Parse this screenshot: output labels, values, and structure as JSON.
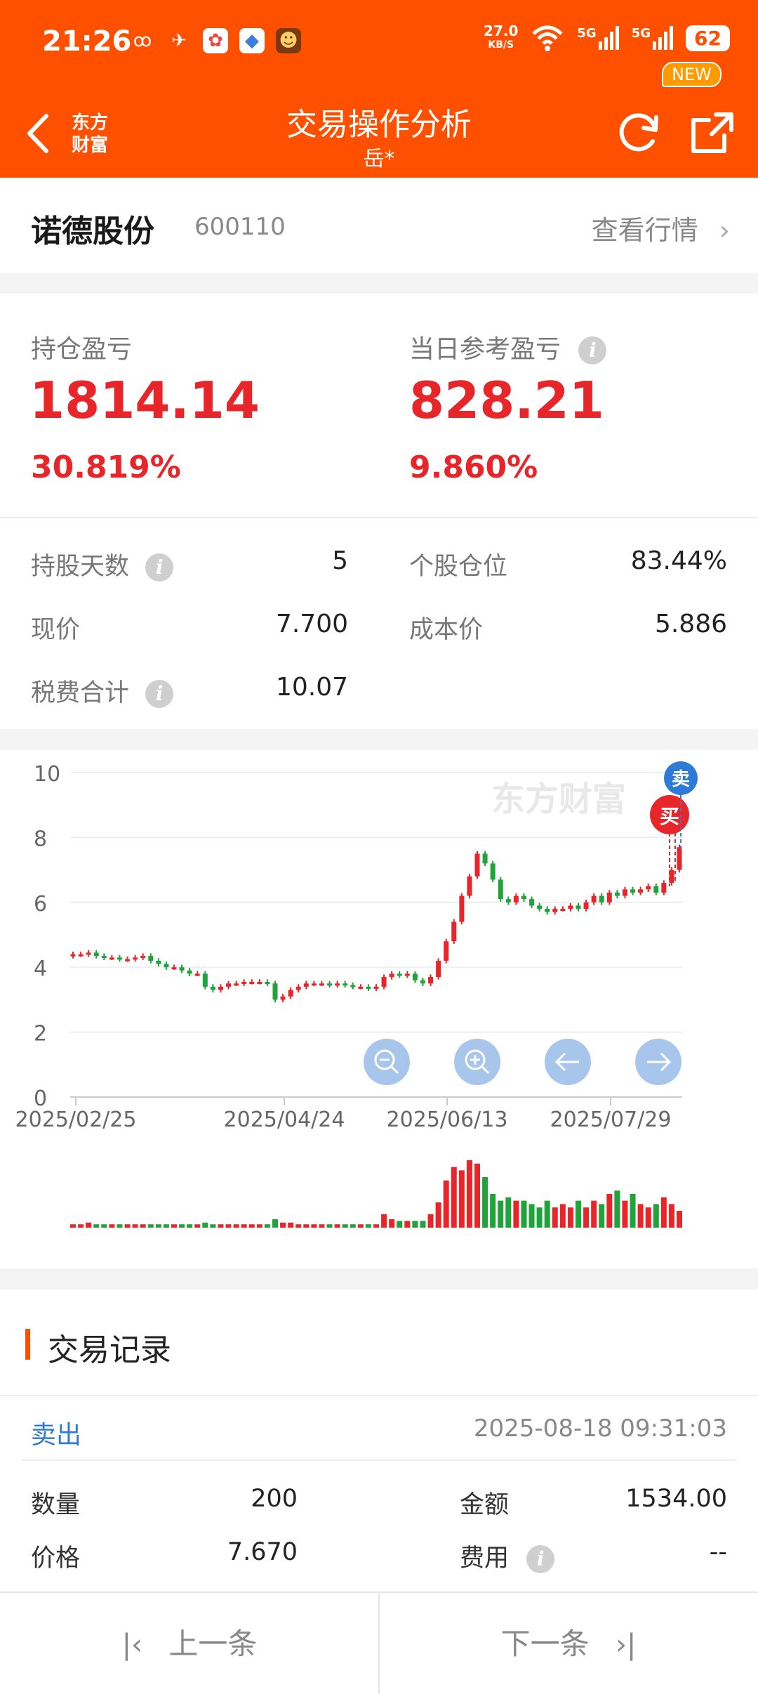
{
  "status": {
    "time": "21:26",
    "net_speed": "27.0",
    "net_unit": "KB/S",
    "sig1": "5G",
    "sig2": "5G",
    "battery": "62"
  },
  "nav": {
    "title": "交易操作分析",
    "subtitle": "岳*",
    "logo_line1": "东方",
    "logo_line2": "财富",
    "new_badge": "NEW"
  },
  "stock": {
    "name": "诺德股份",
    "code": "600110",
    "view_quote": "查看行情"
  },
  "profit": {
    "hold_label": "持仓盈亏",
    "hold_value": "1814.14",
    "hold_pct": "30.819%",
    "day_label": "当日参考盈亏",
    "day_value": "828.21",
    "day_pct": "9.860%"
  },
  "stats": {
    "days_label": "持股天数",
    "days_value": "5",
    "position_label": "个股仓位",
    "position_value": "83.44%",
    "price_label": "现价",
    "price_value": "7.700",
    "cost_label": "成本价",
    "cost_value": "5.886",
    "fee_label": "税费合计",
    "fee_value": "10.07"
  },
  "chart_data": {
    "type": "candlestick",
    "watermark": "东方财富",
    "y_ticks": [
      "10",
      "8",
      "6",
      "4",
      "2",
      "0"
    ],
    "ylim": [
      0,
      10
    ],
    "x_ticks": [
      "2025/02/25",
      "2025/04/24",
      "2025/06/13",
      "2025/07/29"
    ],
    "markers": [
      {
        "label": "卖",
        "color": "#2e7bd6"
      },
      {
        "label": "买",
        "color": "#e8262a"
      }
    ],
    "close_series_approx": [
      4.4,
      4.4,
      4.45,
      4.35,
      4.3,
      4.3,
      4.25,
      4.25,
      4.3,
      4.35,
      4.2,
      4.1,
      4.0,
      4.0,
      3.9,
      3.8,
      3.8,
      3.4,
      3.3,
      3.4,
      3.5,
      3.5,
      3.55,
      3.55,
      3.55,
      3.5,
      3.0,
      3.1,
      3.3,
      3.4,
      3.5,
      3.5,
      3.5,
      3.45,
      3.5,
      3.45,
      3.4,
      3.4,
      3.35,
      3.4,
      3.7,
      3.8,
      3.75,
      3.8,
      3.6,
      3.5,
      3.7,
      4.2,
      4.8,
      5.4,
      6.2,
      6.8,
      7.5,
      7.2,
      6.7,
      6.1,
      6.0,
      6.2,
      6.1,
      5.9,
      5.8,
      5.7,
      5.8,
      5.8,
      5.9,
      5.8,
      6.0,
      6.2,
      6.0,
      6.3,
      6.2,
      6.4,
      6.3,
      6.4,
      6.5,
      6.3,
      6.6,
      7.0,
      7.7
    ],
    "volume_series_approx": [
      2,
      2,
      3,
      2,
      2,
      2,
      2,
      2,
      2,
      2,
      2,
      2,
      2,
      2,
      2,
      2,
      2,
      3,
      2,
      2,
      2,
      2,
      2,
      2,
      2,
      2,
      5,
      3,
      3,
      2,
      2,
      2,
      2,
      2,
      2,
      2,
      2,
      2,
      2,
      2,
      8,
      5,
      4,
      4,
      4,
      4,
      8,
      15,
      28,
      36,
      34,
      40,
      38,
      30,
      20,
      16,
      18,
      16,
      16,
      14,
      12,
      16,
      12,
      14,
      12,
      16,
      12,
      16,
      14,
      20,
      22,
      16,
      20,
      14,
      12,
      14,
      18,
      14,
      10
    ]
  },
  "controls": {
    "zoom_out": "zoom-out",
    "zoom_in": "zoom-in",
    "prev": "left",
    "next": "right"
  },
  "records": {
    "title": "交易记录",
    "type": "卖出",
    "datetime": "2025-08-18 09:31:03",
    "qty_label": "数量",
    "qty_value": "200",
    "amount_label": "金额",
    "amount_value": "1534.00",
    "price_label": "价格",
    "price_value": "7.670",
    "fee_label": "费用",
    "fee_value": "--"
  },
  "bottom": {
    "prev": "上一条",
    "next": "下一条"
  },
  "colors": {
    "brand": "#ff5000",
    "up": "#e8262a",
    "down": "#1fa33a",
    "sell": "#2e7bd6"
  }
}
